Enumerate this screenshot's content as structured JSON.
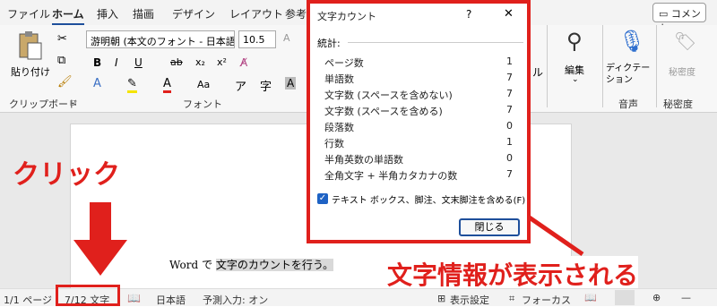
{
  "menubar": {
    "items": [
      "ファイル",
      "ホーム",
      "挿入",
      "描画",
      "デザイン",
      "レイアウト",
      "参考"
    ],
    "comment_label": "コメント"
  },
  "ribbon": {
    "clipboard": {
      "paste_label": "貼り付け",
      "group_label": "クリップボード"
    },
    "font": {
      "font_name": "游明朝 (本文のフォント - 日本語)",
      "font_size": "10.5",
      "group_label": "フォント",
      "bold": "B",
      "italic": "I",
      "underline": "U",
      "strike": "ab",
      "subscript": "x₂",
      "superscript": "x²",
      "aa_label": "Aa"
    },
    "editing": {
      "label": "編集"
    },
    "dictation": {
      "label": "ディクテーション",
      "group_label": "音声"
    },
    "sensitivity": {
      "label": "秘密度",
      "group_label": "秘密度"
    },
    "partial_label": "ル"
  },
  "document": {
    "text_before": "Word で",
    "text_selected": "文字のカウントを行う。"
  },
  "annotation": {
    "click_label": "クリック",
    "result_label": "文字情報が表示される"
  },
  "dialog": {
    "title": "文字カウント",
    "help": "?",
    "close": "✕",
    "stats_heading": "統計:",
    "stats": [
      {
        "label": "ページ数",
        "value": "1"
      },
      {
        "label": "単語数",
        "value": "7"
      },
      {
        "label": "文字数 (スペースを含めない)",
        "value": "7"
      },
      {
        "label": "文字数 (スペースを含める)",
        "value": "7"
      },
      {
        "label": "段落数",
        "value": "0"
      },
      {
        "label": "行数",
        "value": "1"
      },
      {
        "label": "半角英数の単語数",
        "value": "0"
      },
      {
        "label": "全角文字 + 半角カタカナの数",
        "value": "7"
      }
    ],
    "checkbox_label": "テキスト ボックス、脚注、文末脚注を含める(F)",
    "checkbox_checked": true,
    "close_button": "閉じる"
  },
  "statusbar": {
    "page": "1/1 ページ",
    "word_count": "7/12 文字",
    "language": "日本語",
    "predictive": "予測入力: オン",
    "display_settings": "表示設定",
    "focus": "フォーカス"
  },
  "colors": {
    "annotation_red": "#e0201c",
    "accent_blue": "#1e4f9b"
  }
}
